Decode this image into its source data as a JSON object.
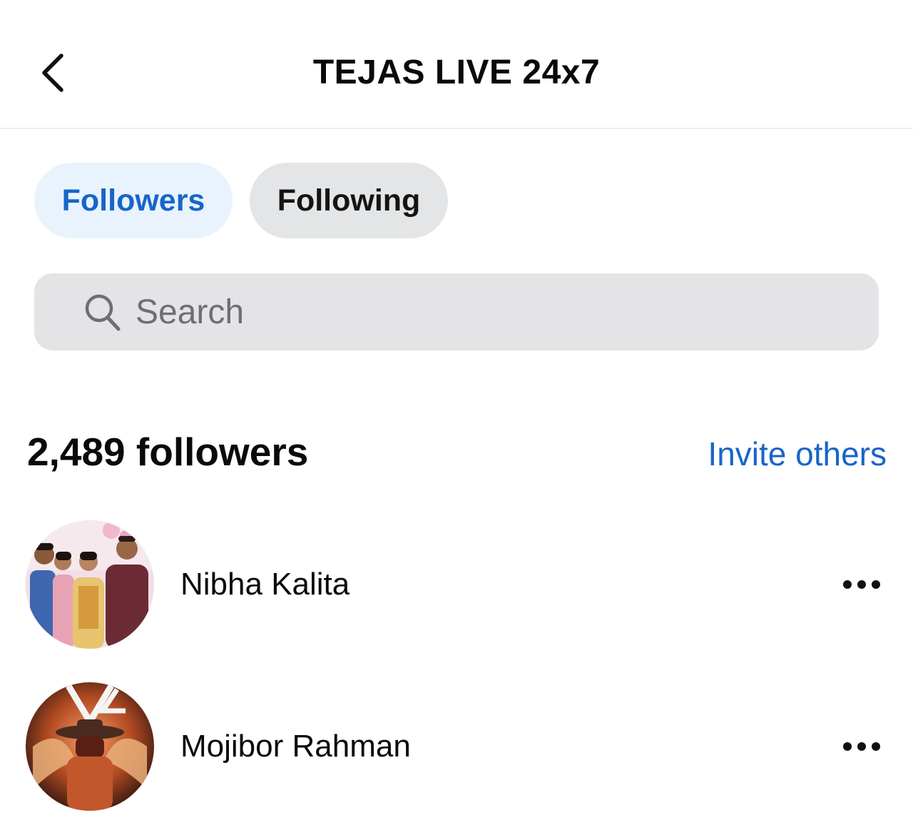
{
  "header": {
    "title": "TEJAS LIVE 24x7",
    "back_icon": "chevron-left-icon"
  },
  "tabs": [
    {
      "label": "Followers",
      "active": true
    },
    {
      "label": "Following",
      "active": false
    }
  ],
  "search": {
    "placeholder": "Search",
    "value": "",
    "icon": "search-icon"
  },
  "summary": {
    "count_text": "2,489 followers",
    "invite_label": "Invite others"
  },
  "followers": [
    {
      "name": "Nibha Kalita",
      "more_icon": "more-horizontal-icon"
    },
    {
      "name": "Mojibor Rahman",
      "more_icon": "more-horizontal-icon"
    }
  ],
  "colors": {
    "accent": "#1865c8",
    "active_tab_bg": "#e8f3fe",
    "inactive_tab_bg": "#e4e5e7",
    "search_bg": "#e4e4e6"
  }
}
